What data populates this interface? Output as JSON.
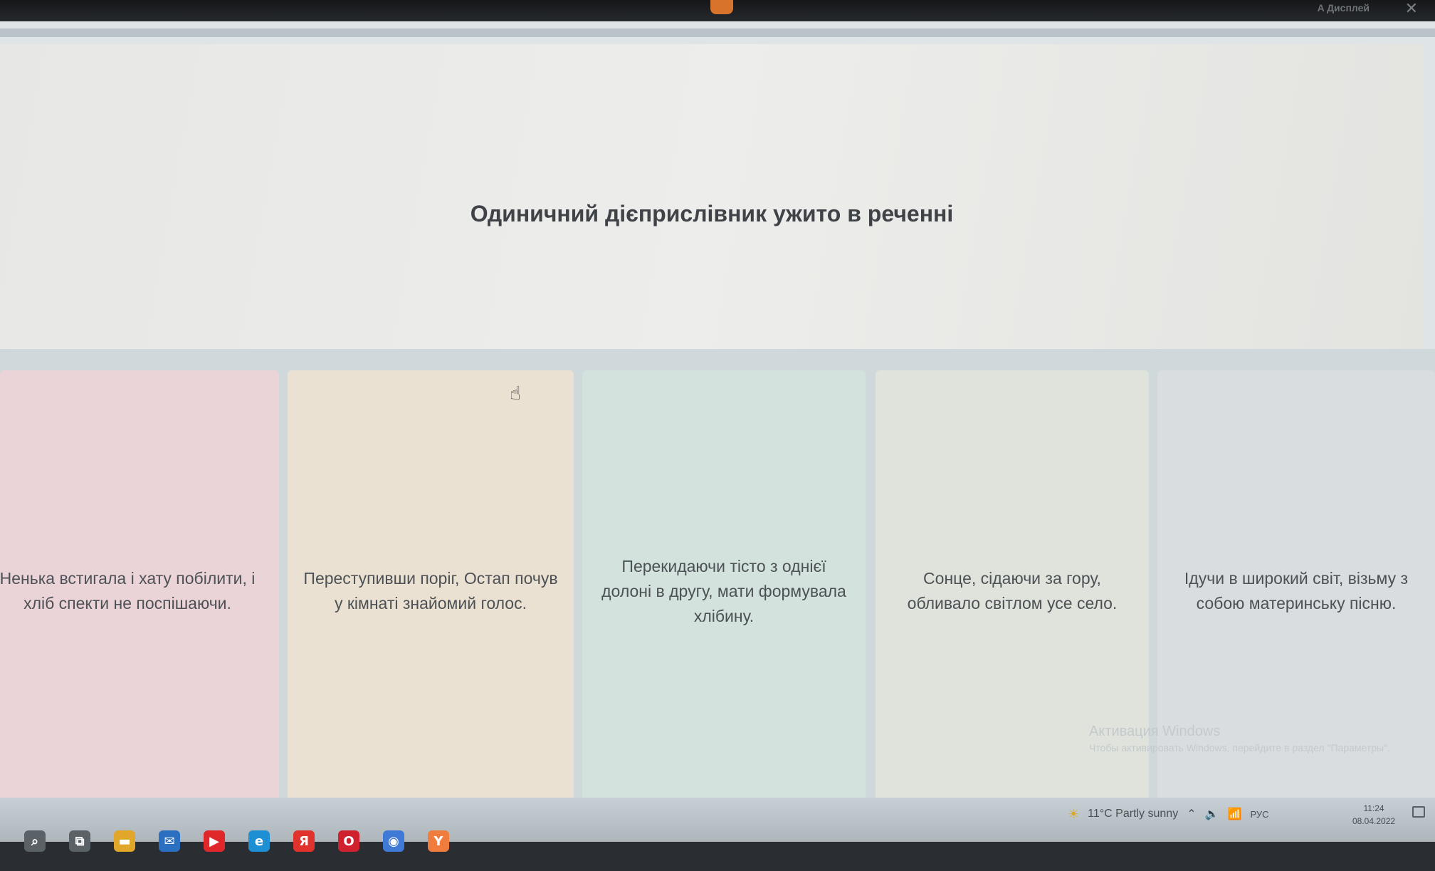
{
  "top_bar": {
    "account_label": "A Дисплей",
    "close_glyph": "✕"
  },
  "question": {
    "text": "Одиничний дієприслівник ужито в реченні"
  },
  "options": [
    {
      "text": "Ненька встигала і хату побілити, і хліб спекти не поспішаючи."
    },
    {
      "text": "Переступивши поріг, Остап почув у кімнаті знайомий голос."
    },
    {
      "text": "Перекидаючи тісто з однієї долоні в другу, мати формувала хлібину."
    },
    {
      "text": "Сонце, сідаючи за гору, обливало світлом усе село."
    },
    {
      "text": "Ідучи в широкий світ, візьму з собою материнську пісню."
    }
  ],
  "activation": {
    "title": "Активация Windows",
    "subtitle": "Чтобы активировать Windows, перейдите в раздел \"Параметры\"."
  },
  "taskbar": {
    "weather": "11°C  Partly sunny",
    "language": "РУС",
    "time": "11:24",
    "date": "08.04.2022",
    "icons": [
      {
        "name": "search-icon",
        "glyph": "⌕",
        "color": "#5a6268"
      },
      {
        "name": "task-view-icon",
        "glyph": "⧉",
        "color": "#5a6268"
      },
      {
        "name": "file-explorer-icon",
        "glyph": "▬",
        "color": "#e1a72b"
      },
      {
        "name": "mail-icon",
        "glyph": "✉",
        "color": "#2b6fc0"
      },
      {
        "name": "youtube-icon",
        "glyph": "▶",
        "color": "#e0282b"
      },
      {
        "name": "edge-icon",
        "glyph": "e",
        "color": "#1f8fd4"
      },
      {
        "name": "yandex-icon",
        "glyph": "Я",
        "color": "#e0332d"
      },
      {
        "name": "opera-icon",
        "glyph": "O",
        "color": "#d0212f"
      },
      {
        "name": "chrome-icon",
        "glyph": "◉",
        "color": "#3f7ad6"
      },
      {
        "name": "yandex-browser-icon",
        "glyph": "Y",
        "color": "#f07c3e"
      }
    ]
  }
}
